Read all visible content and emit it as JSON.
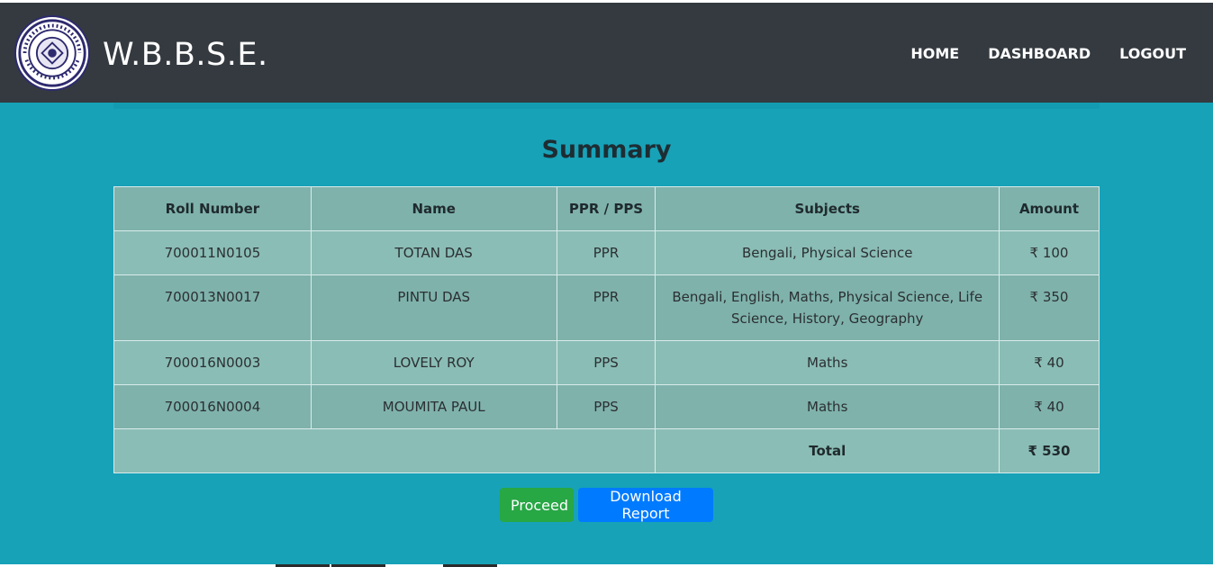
{
  "header": {
    "brand": "W.B.B.S.E.",
    "nav": [
      "HOME",
      "DASHBOARD",
      "LOGOUT"
    ]
  },
  "main": {
    "title": "Summary",
    "table": {
      "columns": [
        "Roll Number",
        "Name",
        "PPR / PPS",
        "Subjects",
        "Amount"
      ],
      "rows": [
        {
          "roll": "700011N0105",
          "name": "TOTAN DAS",
          "type": "PPR",
          "subjects": "Bengali, Physical Science",
          "amount": "₹ 100"
        },
        {
          "roll": "700013N0017",
          "name": "PINTU DAS",
          "type": "PPR",
          "subjects": "Bengali, English, Maths, Physical Science, Life Science, History, Geography",
          "amount": "₹ 350"
        },
        {
          "roll": "700016N0003",
          "name": "LOVELY ROY",
          "type": "PPS",
          "subjects": "Maths",
          "amount": "₹ 40"
        },
        {
          "roll": "700016N0004",
          "name": "MOUMITA PAUL",
          "type": "PPS",
          "subjects": "Maths",
          "amount": "₹ 40"
        }
      ],
      "total_label": "Total",
      "total_amount": "₹ 530"
    },
    "buttons": {
      "proceed": "Proceed",
      "download": "Download Report"
    }
  },
  "colors": {
    "navbar": "#343a40",
    "page_background": "#17a2b8",
    "proceed_button": "#28a745",
    "download_button": "#007bff"
  }
}
